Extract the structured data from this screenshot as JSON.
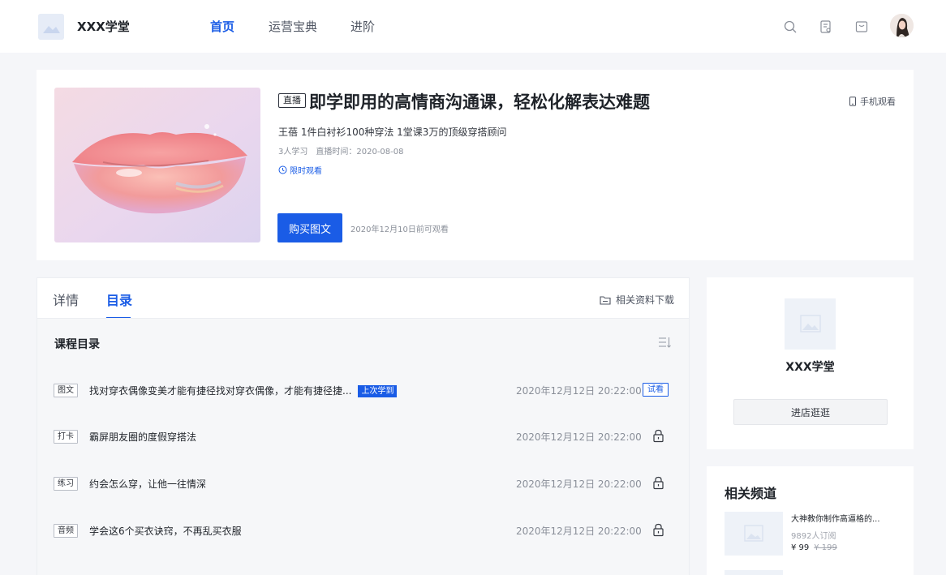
{
  "header": {
    "brand": "XXX学堂",
    "nav": [
      {
        "label": "首页",
        "active": true
      },
      {
        "label": "运营宝典",
        "active": false
      },
      {
        "label": "进阶",
        "active": false
      }
    ],
    "icons": [
      "search-icon",
      "document-icon",
      "bag-icon",
      "user-avatar"
    ]
  },
  "course": {
    "tag": "直播",
    "title": "即学即用的高情商沟通课，轻松化解表达难题",
    "phone_watch": "手机观看",
    "subtitle": "王蓓 1件白衬衫100种穿法 1堂课3万的顶级穿搭顾问",
    "learners": "3人学习",
    "live_time": "直播时间：2020-08-08",
    "limited": "限时观看",
    "buy_label": "购买图文",
    "buy_note": "2020年12月10日前可观看"
  },
  "catalog": {
    "tabs": [
      {
        "label": "详情",
        "active": false
      },
      {
        "label": "目录",
        "active": true
      }
    ],
    "download": "相关资料下载",
    "title": "课程目录",
    "lessons": [
      {
        "type": "图文",
        "name": "找对穿衣偶像变美才能有捷径找对穿衣偶像，才能有捷径捷...",
        "badge": "上次学到",
        "time": "2020年12月12日 20:22:00",
        "action": "试看",
        "locked": false
      },
      {
        "type": "打卡",
        "name": "霸屏朋友圈的度假穿搭法",
        "badge": "",
        "time": "2020年12月12日 20:22:00",
        "action": "",
        "locked": true
      },
      {
        "type": "练习",
        "name": "约会怎么穿，让他一往情深",
        "badge": "",
        "time": "2020年12月12日 20:22:00",
        "action": "",
        "locked": true
      },
      {
        "type": "音频",
        "name": "学会这6个买衣诀窍，不再乱买衣服",
        "badge": "",
        "time": "2020年12月12日 20:22:00",
        "action": "",
        "locked": true
      }
    ]
  },
  "store": {
    "name": "XXX学堂",
    "enter_label": "进店逛逛"
  },
  "related": {
    "title": "相关频道",
    "items": [
      {
        "name": "大神教你制作高逼格的...",
        "subscribers": "9892人订阅",
        "price": "¥ 99",
        "old_price": "¥ 199"
      }
    ]
  },
  "colors": {
    "accent": "#1a5ce6",
    "page_bg": "#f5f6f9"
  }
}
